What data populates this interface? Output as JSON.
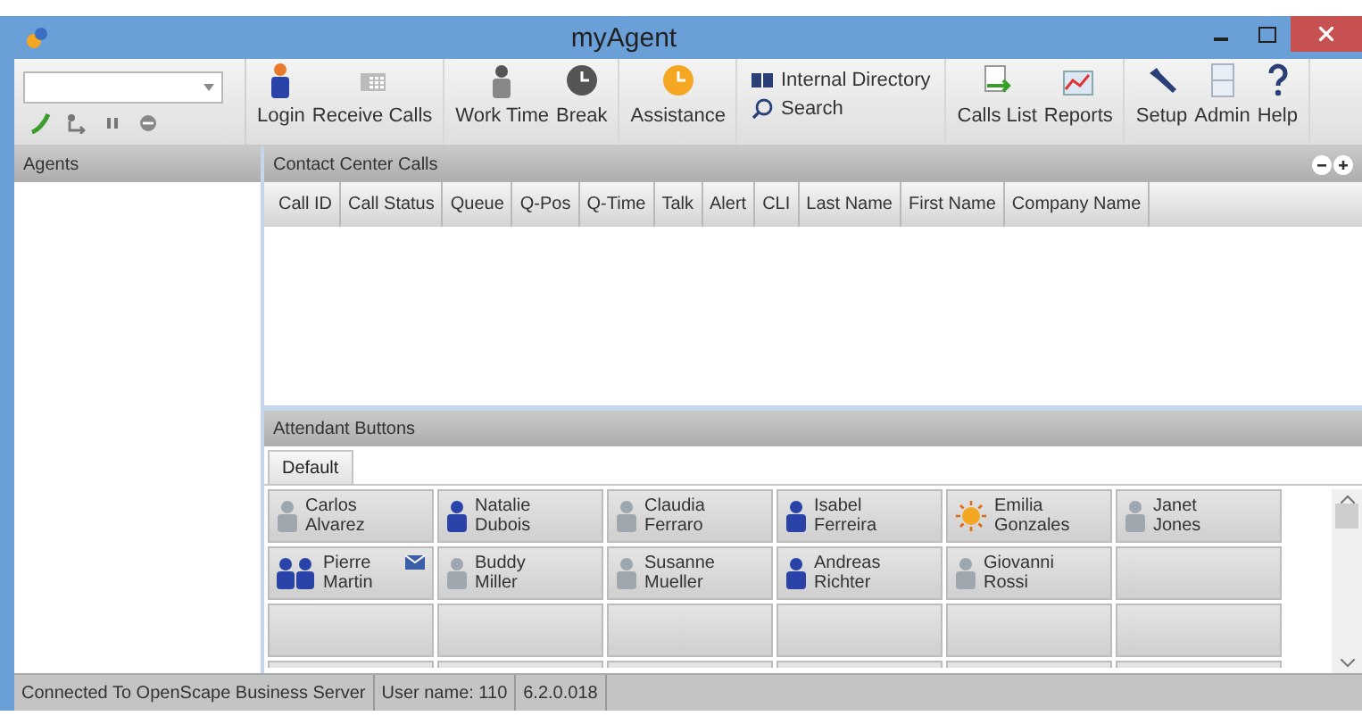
{
  "window": {
    "title": "myAgent"
  },
  "toolbar": {
    "call_controls": [
      {
        "kind": "answer"
      },
      {
        "kind": "transfer"
      },
      {
        "kind": "hold"
      },
      {
        "kind": "hangup"
      }
    ],
    "groups": [
      {
        "kind": "large",
        "items": [
          {
            "kind": "login",
            "label": "Login"
          },
          {
            "kind": "receive",
            "label": "Receive Calls"
          }
        ]
      },
      {
        "kind": "large",
        "items": [
          {
            "kind": "worktime",
            "label": "Work Time"
          },
          {
            "kind": "break",
            "label": "Break"
          }
        ]
      },
      {
        "kind": "large",
        "items": [
          {
            "kind": "assistance",
            "label": "Assistance"
          }
        ]
      },
      {
        "kind": "small",
        "items": [
          {
            "kind": "directory",
            "label": "Internal Directory"
          },
          {
            "kind": "search",
            "label": "Search"
          }
        ]
      },
      {
        "kind": "large",
        "items": [
          {
            "kind": "callslist",
            "label": "Calls List"
          },
          {
            "kind": "reports",
            "label": "Reports"
          }
        ]
      },
      {
        "kind": "large",
        "items": [
          {
            "kind": "setup",
            "label": "Setup"
          },
          {
            "kind": "admin",
            "label": "Admin"
          },
          {
            "kind": "help",
            "label": "Help"
          }
        ]
      }
    ]
  },
  "agents": {
    "title": "Agents"
  },
  "calls": {
    "title": "Contact Center Calls",
    "columns": [
      "Call ID",
      "Call Status",
      "Queue",
      "Q-Pos",
      "Q-Time",
      "Talk",
      "Alert",
      "CLI",
      "Last Name",
      "First Name",
      "Company Name"
    ]
  },
  "attendant": {
    "title": "Attendant Buttons",
    "tabs": [
      {
        "label": "Default",
        "selected": true
      }
    ],
    "buttons": [
      {
        "first": "Carlos",
        "last": "Alvarez",
        "kind": "idle",
        "message": false
      },
      {
        "first": "Natalie",
        "last": "Dubois",
        "kind": "busy",
        "message": false
      },
      {
        "first": "Claudia",
        "last": "Ferraro",
        "kind": "idle",
        "message": false
      },
      {
        "first": "Isabel",
        "last": "Ferreira",
        "kind": "busy",
        "message": false
      },
      {
        "first": "Emilia",
        "last": "Gonzales",
        "kind": "away",
        "message": false
      },
      {
        "first": "Janet",
        "last": "Jones",
        "kind": "idle",
        "message": false
      },
      {
        "first": "Pierre",
        "last": "Martin",
        "kind": "group",
        "message": true
      },
      {
        "first": "Buddy",
        "last": "Miller",
        "kind": "idle",
        "message": false
      },
      {
        "first": "Susanne",
        "last": "Mueller",
        "kind": "idle",
        "message": false
      },
      {
        "first": "Andreas",
        "last": "Richter",
        "kind": "busy",
        "message": false
      },
      {
        "first": "Giovanni",
        "last": "Rossi",
        "kind": "idle",
        "message": false
      }
    ]
  },
  "status_bar": [
    "Connected To OpenScape Business Server",
    "User name: 110",
    "6.2.0.018"
  ]
}
